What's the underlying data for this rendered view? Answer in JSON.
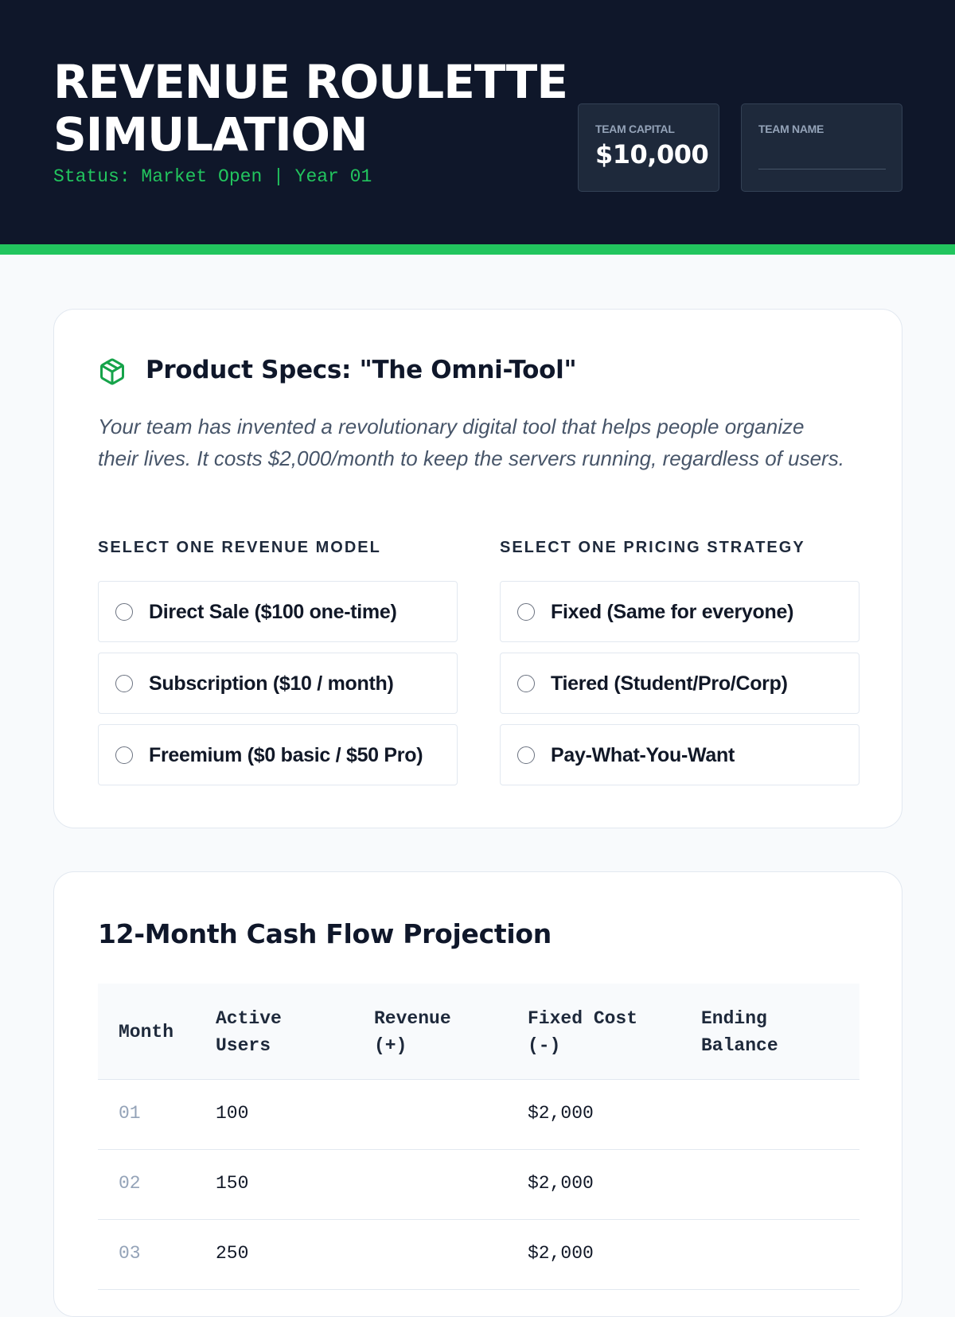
{
  "header": {
    "title": "REVENUE ROULETTE SIMULATION",
    "status": "Status: Market Open | Year 01",
    "capital_label": "TEAM CAPITAL",
    "capital_value": "$10,000",
    "team_name_label": "TEAM NAME",
    "team_name_value": ""
  },
  "colors": {
    "header_bg": "#0f172a",
    "accent": "#22c55e",
    "page_bg": "#f8fafc"
  },
  "product": {
    "icon": "package-icon",
    "title": "Product Specs: \"The Omni-Tool\"",
    "description": "Your team has invented a revolutionary digital tool that helps people organize their lives. It costs $2,000/month to keep the servers running, regardless of users.",
    "revenue_label": "SELECT ONE REVENUE MODEL",
    "pricing_label": "SELECT ONE PRICING STRATEGY",
    "revenue_options": [
      {
        "label": "Direct Sale ($100 one-time)"
      },
      {
        "label": "Subscription ($10 / month)"
      },
      {
        "label": "Freemium ($0 basic / $50 Pro)"
      }
    ],
    "pricing_options": [
      {
        "label": "Fixed (Same for everyone)"
      },
      {
        "label": "Tiered (Student/Pro/Corp)"
      },
      {
        "label": "Pay-What-You-Want"
      }
    ]
  },
  "cashflow": {
    "title": "12-Month Cash Flow Projection",
    "columns": [
      "Month",
      "Active\nUsers",
      "Revenue\n(+)",
      "Fixed Cost\n(-)",
      "Ending\nBalance"
    ],
    "rows": [
      {
        "month": "01",
        "users": "100",
        "revenue": "",
        "cost": "$2,000",
        "balance": ""
      },
      {
        "month": "02",
        "users": "150",
        "revenue": "",
        "cost": "$2,000",
        "balance": ""
      },
      {
        "month": "03",
        "users": "250",
        "revenue": "",
        "cost": "$2,000",
        "balance": ""
      }
    ]
  }
}
